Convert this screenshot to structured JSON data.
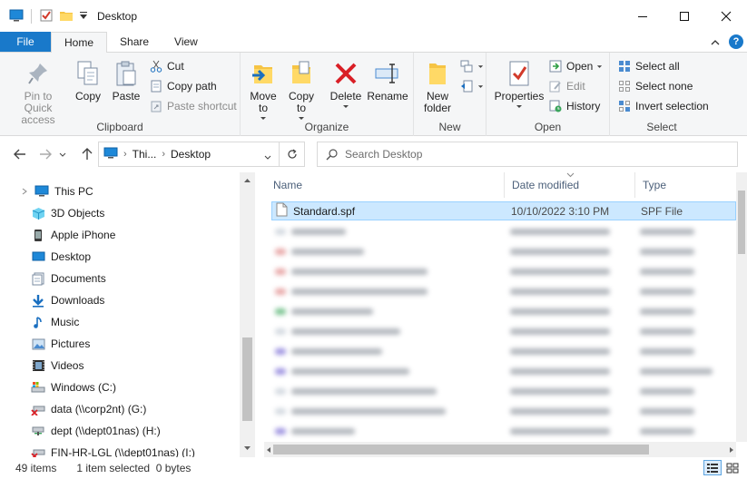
{
  "window": {
    "title": "Desktop"
  },
  "tabs": {
    "file": "File",
    "home": "Home",
    "share": "Share",
    "view": "View"
  },
  "ribbon": {
    "clipboard": {
      "label": "Clipboard",
      "pin": "Pin to Quick access",
      "copy": "Copy",
      "paste": "Paste",
      "cut": "Cut",
      "copy_path": "Copy path",
      "paste_shortcut": "Paste shortcut"
    },
    "organize": {
      "label": "Organize",
      "move_to": "Move to",
      "copy_to": "Copy to",
      "delete": "Delete",
      "rename": "Rename"
    },
    "new": {
      "label": "New",
      "new_folder": "New folder"
    },
    "open": {
      "label": "Open",
      "properties": "Properties",
      "open": "Open",
      "edit": "Edit",
      "history": "History"
    },
    "select": {
      "label": "Select",
      "select_all": "Select all",
      "select_none": "Select none",
      "invert": "Invert selection"
    }
  },
  "address": {
    "crumbs": [
      "Thi...",
      "Desktop"
    ],
    "search_placeholder": "Search Desktop"
  },
  "navpane": {
    "items": [
      {
        "label": "This PC",
        "icon": "pc-icon"
      },
      {
        "label": "3D Objects",
        "icon": "cube-icon"
      },
      {
        "label": "Apple iPhone",
        "icon": "phone-icon"
      },
      {
        "label": "Desktop",
        "icon": "desktop-icon"
      },
      {
        "label": "Documents",
        "icon": "documents-icon"
      },
      {
        "label": "Downloads",
        "icon": "download-icon"
      },
      {
        "label": "Music",
        "icon": "music-icon"
      },
      {
        "label": "Pictures",
        "icon": "pictures-icon"
      },
      {
        "label": "Videos",
        "icon": "videos-icon"
      },
      {
        "label": "Windows (C:)",
        "icon": "drive-icon"
      },
      {
        "label": "data (\\\\corp2nt) (G:)",
        "icon": "network-drive-disconnected-icon"
      },
      {
        "label": "dept (\\\\dept01nas) (H:)",
        "icon": "network-drive-icon"
      },
      {
        "label": "FIN-HR-LGL (\\\\dept01nas) (I:)",
        "icon": "network-drive-disconnected-icon"
      }
    ]
  },
  "filelist": {
    "columns": {
      "name": "Name",
      "date": "Date modified",
      "type": "Type"
    },
    "selected": {
      "name": "Standard.spf",
      "date": "10/10/2022 3:10 PM",
      "type": "SPF File"
    }
  },
  "status": {
    "items": "49 items",
    "selection": "1 item selected  0 bytes"
  },
  "colors": {
    "accent": "#1979ca",
    "selection": "#cce8ff",
    "selection_border": "#99d1ff",
    "ribbon_bg": "#f5f6f7"
  }
}
